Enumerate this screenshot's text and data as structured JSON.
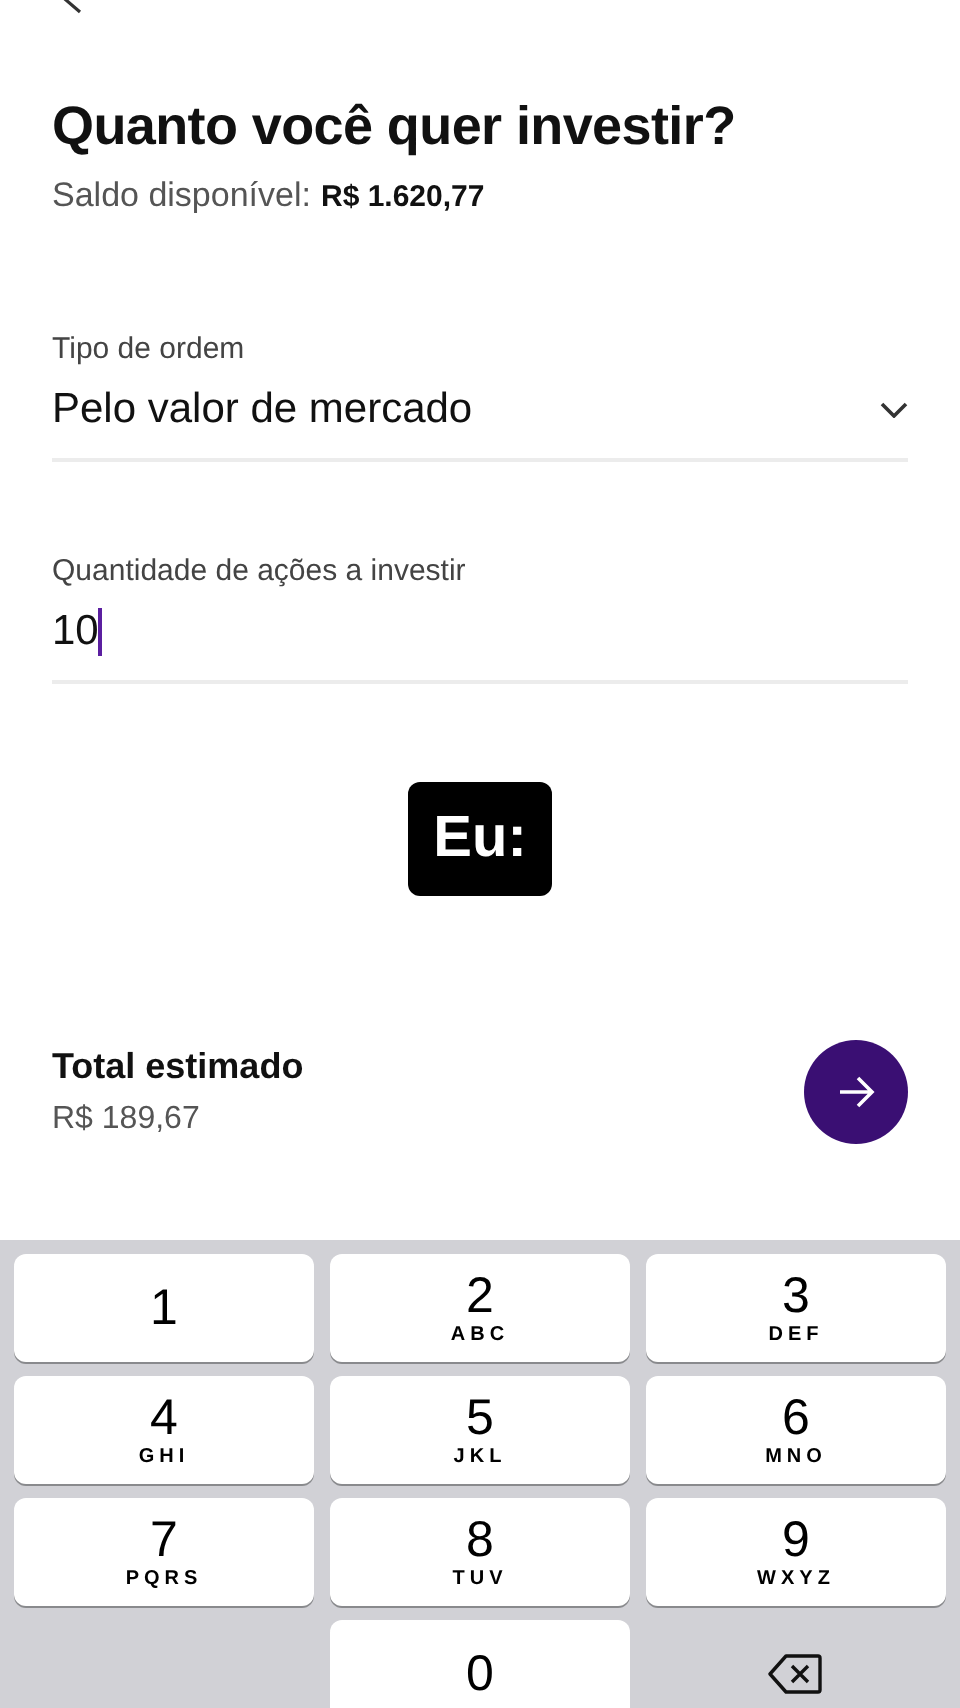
{
  "title": "Quanto você quer investir?",
  "balance": {
    "label": "Saldo disponível:",
    "value": "R$ 1.620,77"
  },
  "order_type": {
    "label": "Tipo de ordem",
    "value": "Pelo valor de mercado"
  },
  "quantity": {
    "label": "Quantidade de ações a investir",
    "value": "10",
    "focused": true
  },
  "caption": "Eu:",
  "total": {
    "label": "Total estimado",
    "value": "R$ 189,67"
  },
  "keypad": [
    {
      "kind": "digit",
      "digit": "1"
    },
    {
      "kind": "digit",
      "digit": "2",
      "letters": "ABC"
    },
    {
      "kind": "digit",
      "digit": "3",
      "letters": "DEF"
    },
    {
      "kind": "digit",
      "digit": "4",
      "letters": "GHI"
    },
    {
      "kind": "digit",
      "digit": "5",
      "letters": "JKL"
    },
    {
      "kind": "digit",
      "digit": "6",
      "letters": "MNO"
    },
    {
      "kind": "digit",
      "digit": "7",
      "letters": "PQRS"
    },
    {
      "kind": "digit",
      "digit": "8",
      "letters": "TUV"
    },
    {
      "kind": "digit",
      "digit": "9",
      "letters": "WXYZ"
    },
    {
      "kind": "digit",
      "digit": "0"
    },
    {
      "kind": "delete"
    }
  ]
}
